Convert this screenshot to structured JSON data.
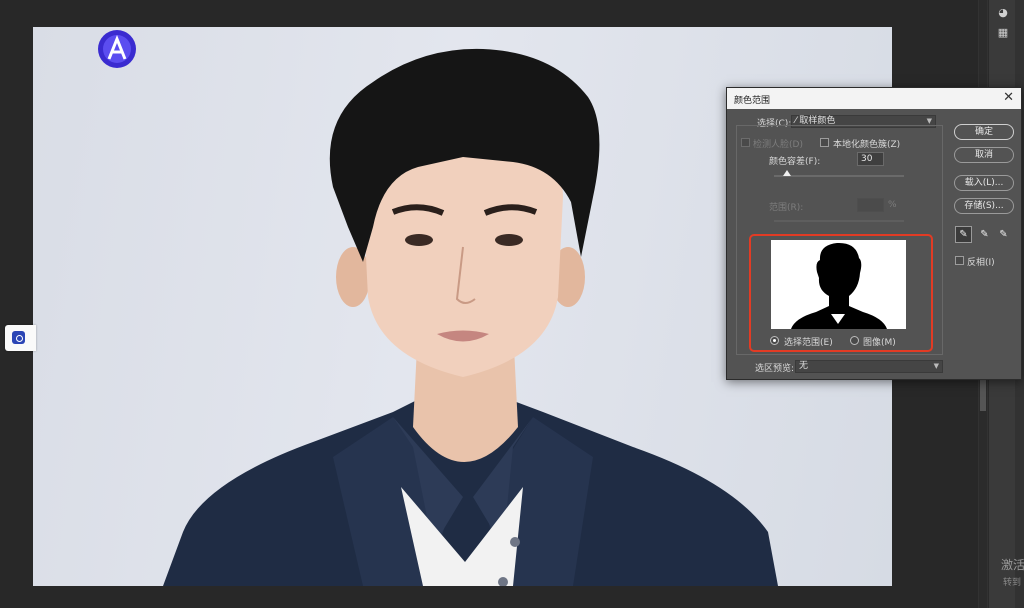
{
  "dialog": {
    "title": "颜色范围",
    "close_glyph": "✕",
    "select_label": "选择(C):",
    "select_value": "取样颜色",
    "detect_faces_label": "检测人脸(D)",
    "localized_label": "本地化颜色簇(Z)",
    "fuzziness_label": "颜色容差(F):",
    "fuzziness_value": "30",
    "fuzziness_level": 0.1,
    "range_label": "范围(R):",
    "range_unit": "%",
    "range_value": "",
    "preview_modes": [
      {
        "label": "选择范围(E)",
        "selected": true
      },
      {
        "label": "图像(M)",
        "selected": false
      }
    ],
    "selection_preview_label": "选区预览:",
    "selection_preview_value": "无",
    "buttons": {
      "ok": "确定",
      "cancel": "取消",
      "load": "载入(L)...",
      "save": "存储(S)..."
    },
    "invert_label": "反相(I)",
    "eyedroppers": [
      {
        "icon": "eyedropper-icon",
        "glyph": "✎"
      },
      {
        "icon": "eyedropper-plus-icon",
        "glyph": "✎"
      },
      {
        "icon": "eyedropper-minus-icon",
        "glyph": "✎"
      }
    ]
  },
  "watermark": {
    "line1": "激活",
    "line2": "转到"
  },
  "colors": {
    "dialog_bg": "#535353",
    "highlight_frame": "#e23b24",
    "workspace": "#282828"
  }
}
